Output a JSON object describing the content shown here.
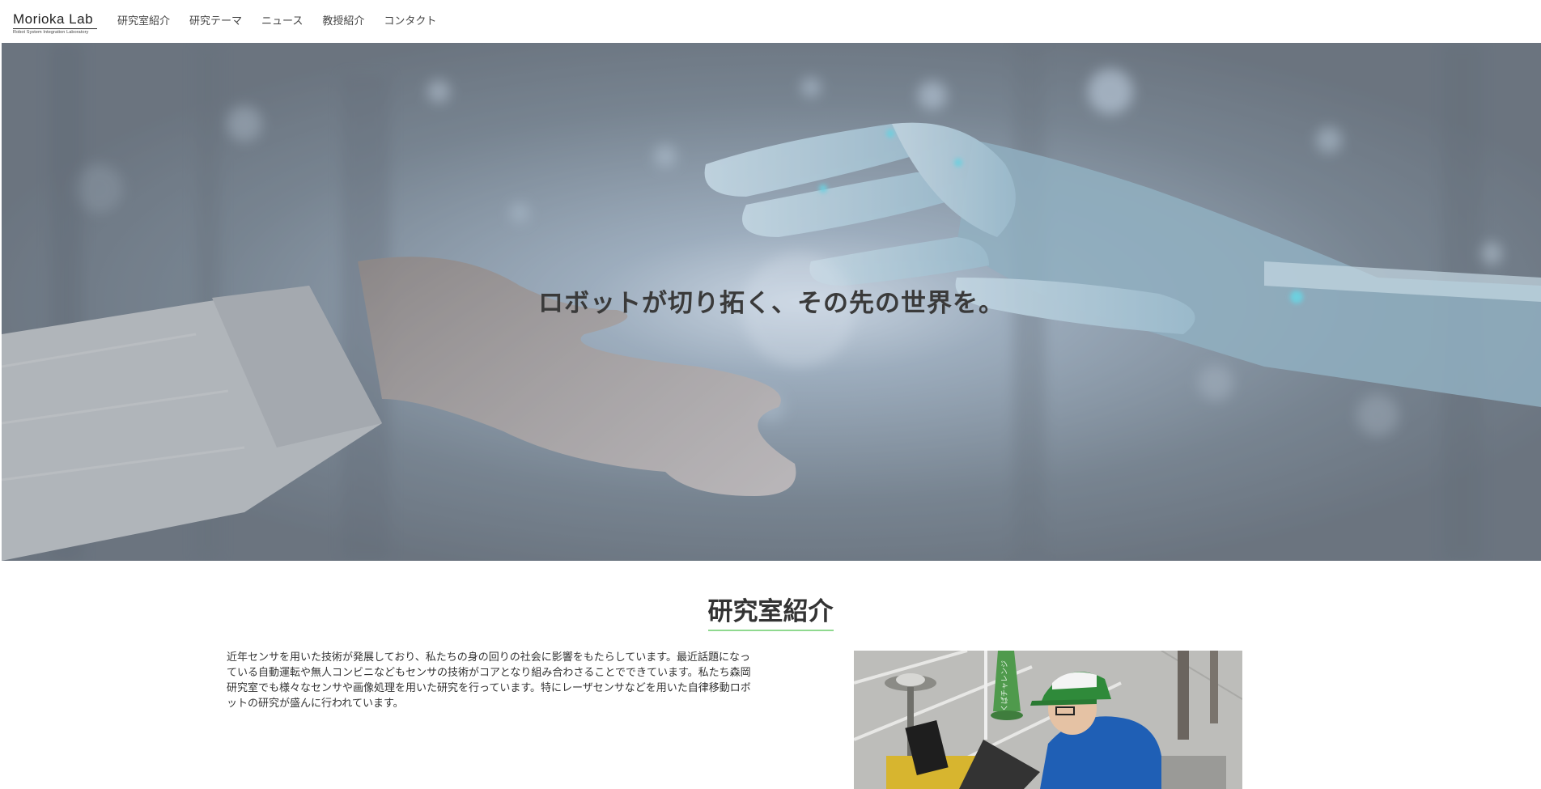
{
  "header": {
    "logo_main": "Morioka Lab",
    "logo_sub": "Robot System Integration Laboratory",
    "nav": [
      {
        "label": "研究室紹介"
      },
      {
        "label": "研究テーマ"
      },
      {
        "label": "ニュース"
      },
      {
        "label": "教授紹介"
      },
      {
        "label": "コンタクト"
      }
    ]
  },
  "hero": {
    "title": "ロボットが切り拓く、その先の世界を。"
  },
  "about": {
    "heading": "研究室紹介",
    "body": "近年センサを用いた技術が発展しており、私たちの身の回りの社会に影響をもたらしています。最近話題になっている自動運転や無人コンビニなどもセンサの技術がコアとなり組み合わさることでできています。私たち森岡研究室でも様々なセンサや画像処理を用いた研究を行っています。特にレーザセンサなどを用いた自律移動ロボットの研究が盛んに行われています。",
    "photo_sign_text": "つくばチャレンジ"
  },
  "colors": {
    "accent_underline": "#8fd98f",
    "hero_base": "#6f7c88",
    "text": "#333333"
  }
}
